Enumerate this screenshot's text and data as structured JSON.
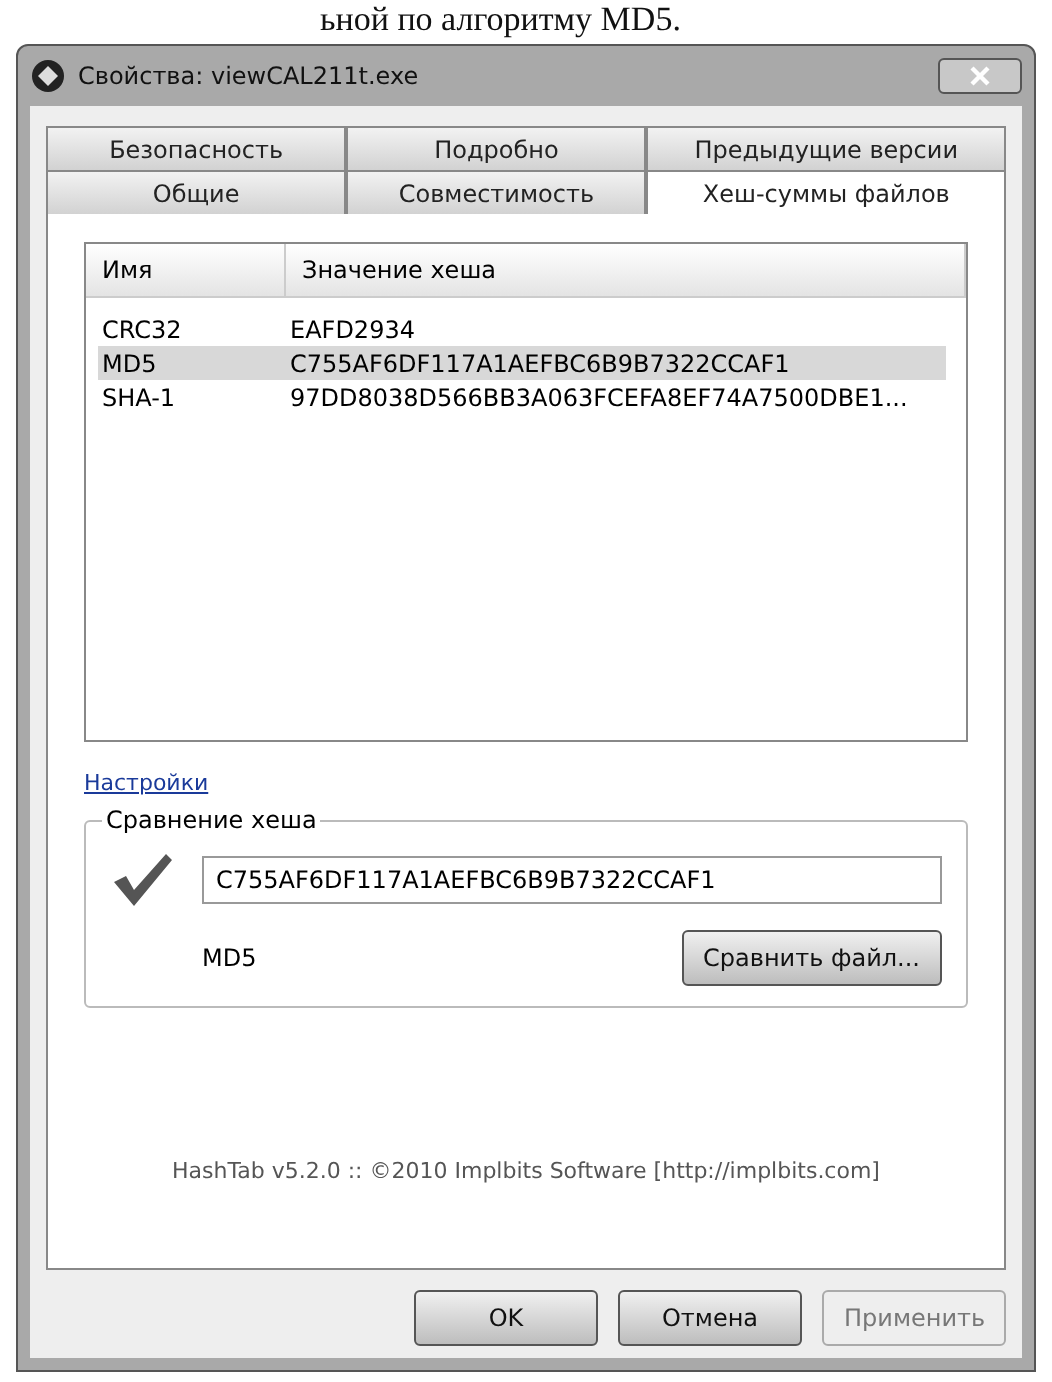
{
  "document_text": "ьной по алгоритму MD5.",
  "window": {
    "title": "Свойства: viewCAL211t.exe"
  },
  "tab_rows": [
    [
      {
        "label": "Безопасность",
        "selected": false
      },
      {
        "label": "Подробно",
        "selected": false
      },
      {
        "label": "Предыдущие версии",
        "selected": false
      }
    ],
    [
      {
        "label": "Общие",
        "selected": false
      },
      {
        "label": "Совместимость",
        "selected": false
      },
      {
        "label": "Хеш-суммы файлов",
        "selected": true
      }
    ]
  ],
  "table": {
    "columns": [
      "Имя",
      "Значение хеша"
    ],
    "rows": [
      {
        "name": "CRC32",
        "value": "EAFD2934",
        "selected": false
      },
      {
        "name": "MD5",
        "value": "C755AF6DF117A1AEFBC6B9B7322CCAF1",
        "selected": true
      },
      {
        "name": "SHA-1",
        "value": "97DD8038D566BB3A063FCEFA8EF74A7500DBE1...",
        "selected": false
      }
    ]
  },
  "settings_link": "Настройки",
  "compare": {
    "title": "Сравнение хеша",
    "value": "C755AF6DF117A1AEFBC6B9B7322CCAF1",
    "algorithm": "MD5",
    "button": "Сравнить файл..."
  },
  "footer": "HashTab v5.2.0 :: ©2010 Implbits Software [http://implbits.com]",
  "buttons": [
    {
      "label": "OK",
      "disabled": false
    },
    {
      "label": "Отмена",
      "disabled": false
    },
    {
      "label": "Применить",
      "disabled": true
    }
  ]
}
